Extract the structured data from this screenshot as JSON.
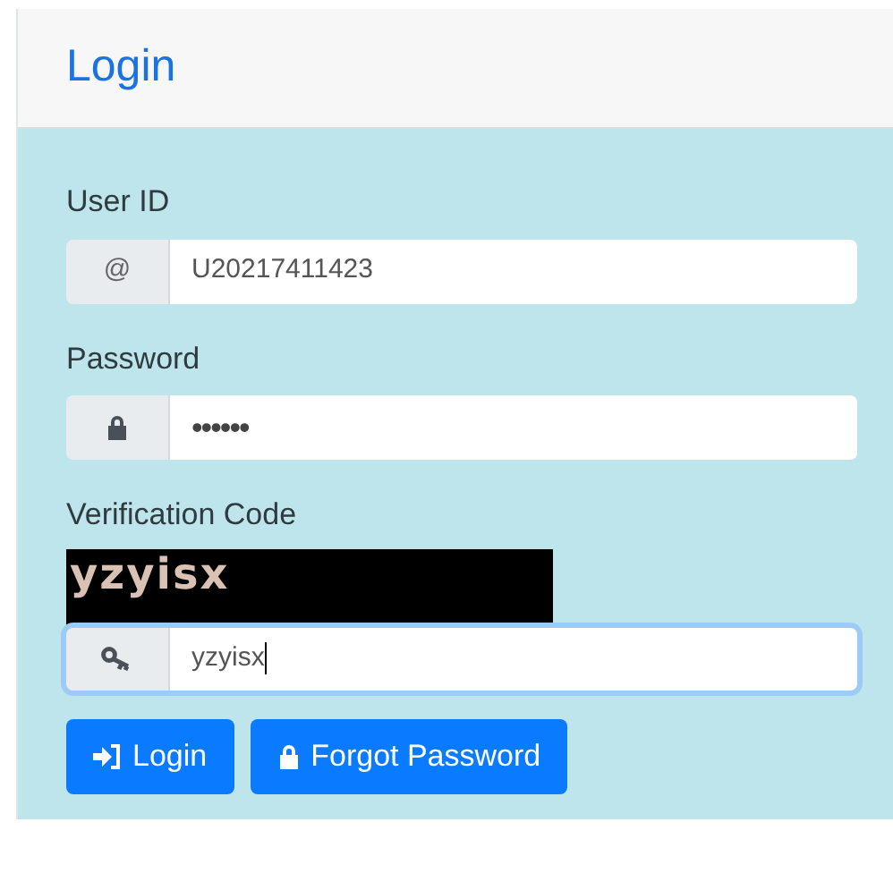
{
  "card": {
    "title": "Login"
  },
  "fields": [
    {
      "kind": "text",
      "label": "User ID",
      "addon": "@",
      "value": "U20217411423",
      "focused": false
    },
    {
      "kind": "password",
      "label": "Password",
      "value": "••••••",
      "focused": false
    },
    {
      "kind": "captcha",
      "label": "Verification Code",
      "captcha": "yzyisx",
      "value": "yzyisx",
      "focused": true
    }
  ],
  "buttons": [
    {
      "kind": "login",
      "label": "Login"
    },
    {
      "kind": "forgot",
      "label": "Forgot Password"
    }
  ]
}
